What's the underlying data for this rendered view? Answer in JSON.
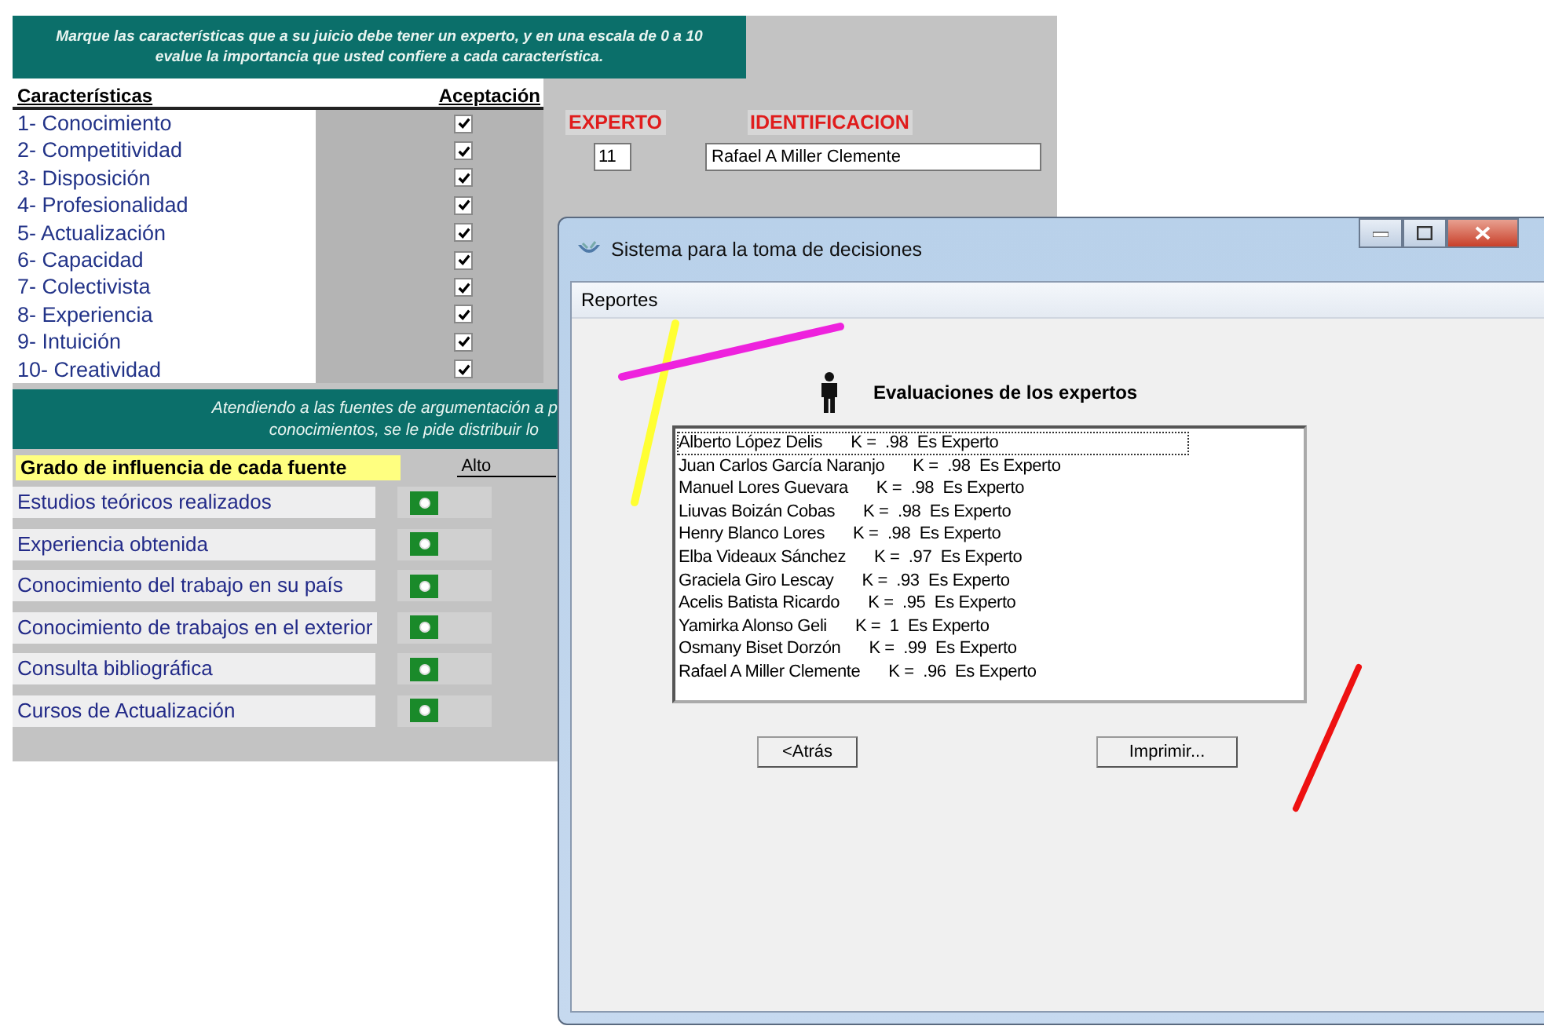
{
  "background_form": {
    "instructions": [
      "Marque las características que a su juicio debe tener un experto, y en una escala de 0 a 10",
      "evalue la importancia que usted confiere a cada característica."
    ],
    "characteristics_header": "Características",
    "acceptance_header": "Aceptación",
    "characteristics": [
      {
        "label": "1- Conocimiento",
        "checked": true
      },
      {
        "label": "2- Competitividad",
        "checked": true
      },
      {
        "label": "3- Disposición",
        "checked": true
      },
      {
        "label": "4- Profesionalidad",
        "checked": true
      },
      {
        "label": "5- Actualización",
        "checked": true
      },
      {
        "label": "6- Capacidad",
        "checked": true
      },
      {
        "label": "7- Colectivista",
        "checked": true
      },
      {
        "label": "8- Experiencia",
        "checked": true
      },
      {
        "label": "9- Intuición",
        "checked": true
      },
      {
        "label": "10- Creatividad",
        "checked": true
      }
    ],
    "expert_label": "EXPERTO",
    "identification_label": "IDENTIFICACION",
    "expert_number": "11",
    "expert_name": "Rafael A Miller Clemente",
    "sources_instructions": [
      "Atendiendo a las fuentes de argumentación a p",
      "conocimientos, se le pide distribuir lo"
    ],
    "sources_header": "Grado de influencia de cada fuente",
    "level_header": "Alto",
    "sources": [
      {
        "label": "Estudios teóricos realizados",
        "selected": true
      },
      {
        "label": "Experiencia obtenida",
        "selected": true
      },
      {
        "label": "Conocimiento del trabajo en su país",
        "selected": true
      },
      {
        "label": "Conocimiento de trabajos en el exterior",
        "selected": true
      },
      {
        "label": "Consulta bibliográfica",
        "selected": true
      },
      {
        "label": "Cursos de Actualización",
        "selected": true
      }
    ]
  },
  "window": {
    "title": "Sistema para la toma de decisiones",
    "menu": [
      "Reportes"
    ],
    "heading": "Evaluaciones de los expertos",
    "experts": [
      {
        "name": "Alberto López Delis",
        "score": "K =  .98  Es Experto",
        "selected": true
      },
      {
        "name": "Juan Carlos García Naranjo",
        "score": "K =  .98  Es Experto",
        "selected": false
      },
      {
        "name": "Manuel Lores Guevara",
        "score": "K =  .98  Es Experto",
        "selected": false
      },
      {
        "name": "Liuvas Boizán Cobas",
        "score": "K =  .98  Es Experto",
        "selected": false
      },
      {
        "name": "Henry Blanco Lores",
        "score": "K =  .98  Es Experto",
        "selected": false
      },
      {
        "name": "Elba Videaux Sánchez",
        "score": "K =  .97  Es Experto",
        "selected": false
      },
      {
        "name": "Graciela Giro Lescay",
        "score": "K =  .93  Es Experto",
        "selected": false
      },
      {
        "name": "Acelis Batista Ricardo",
        "score": "K =  .95  Es Experto",
        "selected": false
      },
      {
        "name": "Yamirka Alonso Geli",
        "score": "K =  1  Es Experto",
        "selected": false
      },
      {
        "name": "Osmany Biset Dorzón",
        "score": "K =  .99  Es Experto",
        "selected": false
      },
      {
        "name": "Rafael A Miller Clemente",
        "score": "K =  .96  Es Experto",
        "selected": false
      }
    ],
    "buttons": [
      "<Atrás",
      "Imprimir..."
    ]
  }
}
